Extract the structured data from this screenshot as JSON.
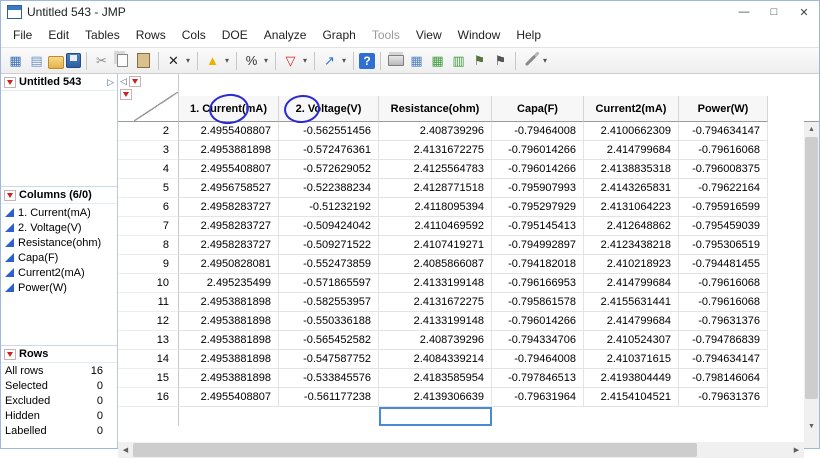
{
  "window": {
    "title": "Untitled 543 - JMP",
    "minimize": "—",
    "maximize": "□",
    "close": "✕"
  },
  "menu": {
    "items": [
      {
        "label": "File",
        "enabled": true
      },
      {
        "label": "Edit",
        "enabled": true
      },
      {
        "label": "Tables",
        "enabled": true
      },
      {
        "label": "Rows",
        "enabled": true
      },
      {
        "label": "Cols",
        "enabled": true
      },
      {
        "label": "DOE",
        "enabled": true
      },
      {
        "label": "Analyze",
        "enabled": true
      },
      {
        "label": "Graph",
        "enabled": true
      },
      {
        "label": "Tools",
        "enabled": false
      },
      {
        "label": "View",
        "enabled": true
      },
      {
        "label": "Window",
        "enabled": true
      },
      {
        "label": "Help",
        "enabled": true
      }
    ]
  },
  "toolbar": {
    "items": [
      {
        "type": "icon",
        "name": "new-data-table-icon",
        "glyph": "▦",
        "color": "#3a6fb5"
      },
      {
        "type": "icon",
        "name": "new-journal-icon",
        "glyph": "▤",
        "color": "#6f93c4"
      },
      {
        "type": "icon",
        "name": "open-icon",
        "cls": "folder"
      },
      {
        "type": "icon",
        "name": "save-icon",
        "cls": "save"
      },
      {
        "type": "sep"
      },
      {
        "type": "icon",
        "name": "cut-icon",
        "glyph": "✂",
        "color": "#8a8a8a"
      },
      {
        "type": "icon",
        "name": "copy-icon",
        "cls": "copy"
      },
      {
        "type": "icon",
        "name": "paste-icon",
        "cls": "paste"
      },
      {
        "type": "sep"
      },
      {
        "type": "icon",
        "name": "selection-tool-icon",
        "glyph": "✕",
        "color": "#222222"
      },
      {
        "type": "caret"
      },
      {
        "type": "sep"
      },
      {
        "type": "icon",
        "name": "warning-triangle-icon",
        "glyph": "▲",
        "color": "#e6b400"
      },
      {
        "type": "caret"
      },
      {
        "type": "sep"
      },
      {
        "type": "icon",
        "name": "percent-format-icon",
        "glyph": "%",
        "color": "#333333"
      },
      {
        "type": "caret"
      },
      {
        "type": "sep"
      },
      {
        "type": "icon",
        "name": "data-filter-icon",
        "glyph": "▽",
        "color": "#cc2222"
      },
      {
        "type": "caret"
      },
      {
        "type": "sep"
      },
      {
        "type": "icon",
        "name": "graph-builder-icon",
        "glyph": "↗",
        "color": "#2f6fd0"
      },
      {
        "type": "caret"
      },
      {
        "type": "sep"
      },
      {
        "type": "icon",
        "name": "help-icon",
        "glyph": "?",
        "cls": "help"
      },
      {
        "type": "sep"
      },
      {
        "type": "icon",
        "name": "print-icon",
        "cls": "printer"
      },
      {
        "type": "icon",
        "name": "layout-icon",
        "glyph": "▦",
        "color": "#4f81bd"
      },
      {
        "type": "icon",
        "name": "table-grid-icon",
        "glyph": "▦",
        "color": "#3f9c3f"
      },
      {
        "type": "icon",
        "name": "table-grid2-icon",
        "glyph": "▥",
        "color": "#3f9c3f"
      },
      {
        "type": "icon",
        "name": "flag-icon",
        "glyph": "⚑",
        "color": "#557744"
      },
      {
        "type": "icon",
        "name": "flag2-icon",
        "glyph": "⚑",
        "color": "#555555"
      },
      {
        "type": "sep"
      },
      {
        "type": "icon",
        "name": "preferences-wrench-icon",
        "cls": "wrench"
      },
      {
        "type": "caret"
      }
    ]
  },
  "sidebar": {
    "table_panel": {
      "title": "Untitled 543"
    },
    "columns_panel": {
      "title": "Columns (6/0)",
      "items": [
        "1. Current(mA)",
        "2. Voltage(V)",
        "Resistance(ohm)",
        "Capa(F)",
        "Current2(mA)",
        "Power(W)"
      ]
    },
    "rows_panel": {
      "title": "Rows",
      "stats": [
        {
          "label": "All rows",
          "value": "16"
        },
        {
          "label": "Selected",
          "value": "0"
        },
        {
          "label": "Excluded",
          "value": "0"
        },
        {
          "label": "Hidden",
          "value": "0"
        },
        {
          "label": "Labelled",
          "value": "0"
        }
      ]
    }
  },
  "table": {
    "columns": [
      "1. Current(mA)",
      "2. Voltage(V)",
      "Resistance(ohm)",
      "Capa(F)",
      "Current2(mA)",
      "Power(W)"
    ],
    "rows": [
      {
        "n": "2",
        "values": [
          "2.4955408807",
          "-0.562551456",
          "2.408739296",
          "-0.79464008",
          "2.4100662309",
          "-0.794634147"
        ]
      },
      {
        "n": "3",
        "values": [
          "2.4953881898",
          "-0.572476361",
          "2.4131672275",
          "-0.796014266",
          "2.414799684",
          "-0.79616068"
        ]
      },
      {
        "n": "4",
        "values": [
          "2.4955408807",
          "-0.572629052",
          "2.4125564783",
          "-0.796014266",
          "2.4138835318",
          "-0.796008375"
        ]
      },
      {
        "n": "5",
        "values": [
          "2.4956758527",
          "-0.522388234",
          "2.4128771518",
          "-0.795907993",
          "2.4143265831",
          "-0.79622164"
        ]
      },
      {
        "n": "6",
        "values": [
          "2.4958283727",
          "-0.51232192",
          "2.4118095394",
          "-0.795297929",
          "2.4131064223",
          "-0.795916599"
        ]
      },
      {
        "n": "7",
        "values": [
          "2.4958283727",
          "-0.509424042",
          "2.4110469592",
          "-0.795145413",
          "2.412648862",
          "-0.795459039"
        ]
      },
      {
        "n": "8",
        "values": [
          "2.4958283727",
          "-0.509271522",
          "2.4107419271",
          "-0.794992897",
          "2.4123438218",
          "-0.795306519"
        ]
      },
      {
        "n": "9",
        "values": [
          "2.4950828081",
          "-0.552473859",
          "2.4085866087",
          "-0.794182018",
          "2.410218923",
          "-0.794481455"
        ]
      },
      {
        "n": "10",
        "values": [
          "2.495235499",
          "-0.571865597",
          "2.4133199148",
          "-0.796166953",
          "2.414799684",
          "-0.79616068"
        ]
      },
      {
        "n": "11",
        "values": [
          "2.4953881898",
          "-0.582553957",
          "2.4131672275",
          "-0.795861578",
          "2.4155631441",
          "-0.79616068"
        ]
      },
      {
        "n": "12",
        "values": [
          "2.4953881898",
          "-0.550336188",
          "2.4133199148",
          "-0.796014266",
          "2.414799684",
          "-0.79631376"
        ]
      },
      {
        "n": "13",
        "values": [
          "2.4953881898",
          "-0.565452582",
          "2.408739296",
          "-0.794334706",
          "2.410524307",
          "-0.794786839"
        ]
      },
      {
        "n": "14",
        "values": [
          "2.4953881898",
          "-0.547587752",
          "2.4084339214",
          "-0.79464008",
          "2.410371615",
          "-0.794634147"
        ]
      },
      {
        "n": "15",
        "values": [
          "2.4953881898",
          "-0.533845576",
          "2.4183585954",
          "-0.797846513",
          "2.4193804449",
          "-0.798146064"
        ]
      },
      {
        "n": "16",
        "values": [
          "2.4955408807",
          "-0.561177238",
          "2.4139306639",
          "-0.79631964",
          "2.4154104521",
          "-0.79631376"
        ]
      }
    ]
  },
  "annotations": [
    {
      "name": "circle-1",
      "around": "1."
    },
    {
      "name": "circle-2",
      "around": "2."
    }
  ]
}
